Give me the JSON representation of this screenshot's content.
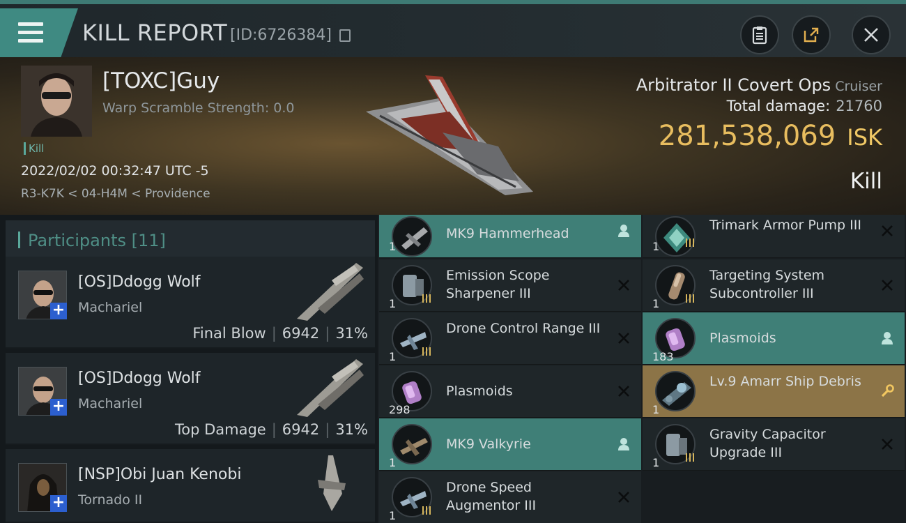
{
  "header": {
    "title": "KILL REPORT",
    "report_id": "[ID:6726384]"
  },
  "victim": {
    "name": "[TOXC]Guy",
    "warp_scramble": "Warp Scramble Strength: 0.0",
    "tag": "Kill",
    "timestamp": "2022/02/02 00:32:47 UTC -5",
    "location": "R3-K7K < 04-H4M < Providence",
    "ship": "Arbitrator II Covert Ops",
    "ship_class": "Cruiser",
    "total_damage_label": "Total damage:",
    "total_damage": "21760",
    "isk_value": "281,538,069",
    "isk_unit": "ISK",
    "result": "Kill"
  },
  "participants": {
    "label": "Participants [11]",
    "rows": [
      {
        "name": "[OS]Ddogg Wolf",
        "ship": "Machariel",
        "role": "Final Blow",
        "damage": "6942",
        "percent": "31%"
      },
      {
        "name": "[OS]Ddogg Wolf",
        "ship": "Machariel",
        "role": "Top Damage",
        "damage": "6942",
        "percent": "31%"
      },
      {
        "name": "[NSP]Obi Juan Kenobi",
        "ship": "Tornado II",
        "role": "",
        "damage": "",
        "percent": ""
      }
    ]
  },
  "items_left": [
    {
      "qty": "1",
      "name": "MK9 Hammerhead",
      "state": "dropped",
      "icon": "drone-icon"
    },
    {
      "qty": "1",
      "name": "Emission Scope Sharpener III",
      "state": "destroyed",
      "icon": "module-icon"
    },
    {
      "qty": "1",
      "name": "Drone Control Range III",
      "state": "destroyed",
      "icon": "drone-module-icon"
    },
    {
      "qty": "298",
      "name": "Plasmoids",
      "state": "destroyed",
      "icon": "plasmoid-icon"
    },
    {
      "qty": "1",
      "name": "MK9 Valkyrie",
      "state": "dropped",
      "icon": "drone-icon"
    },
    {
      "qty": "1",
      "name": "Drone Speed Augmentor III",
      "state": "destroyed",
      "icon": "drone-module-icon"
    }
  ],
  "items_right": [
    {
      "qty": "1",
      "name": "Trimark Armor Pump III",
      "state": "destroyed",
      "icon": "rig-icon"
    },
    {
      "qty": "1",
      "name": "Targeting System Subcontroller III",
      "state": "destroyed",
      "icon": "module-icon"
    },
    {
      "qty": "183",
      "name": "Plasmoids",
      "state": "dropped",
      "icon": "plasmoid-icon"
    },
    {
      "qty": "1",
      "name": "Lv.9 Amarr Ship Debris",
      "state": "salvage",
      "icon": "debris-icon"
    },
    {
      "qty": "1",
      "name": "Gravity Capacitor Upgrade III",
      "state": "destroyed",
      "icon": "module-icon"
    }
  ],
  "colors": {
    "accent_teal": "#3f7f77",
    "isk_gold": "#e8bd5f",
    "salvage_gold": "#8c7447"
  }
}
